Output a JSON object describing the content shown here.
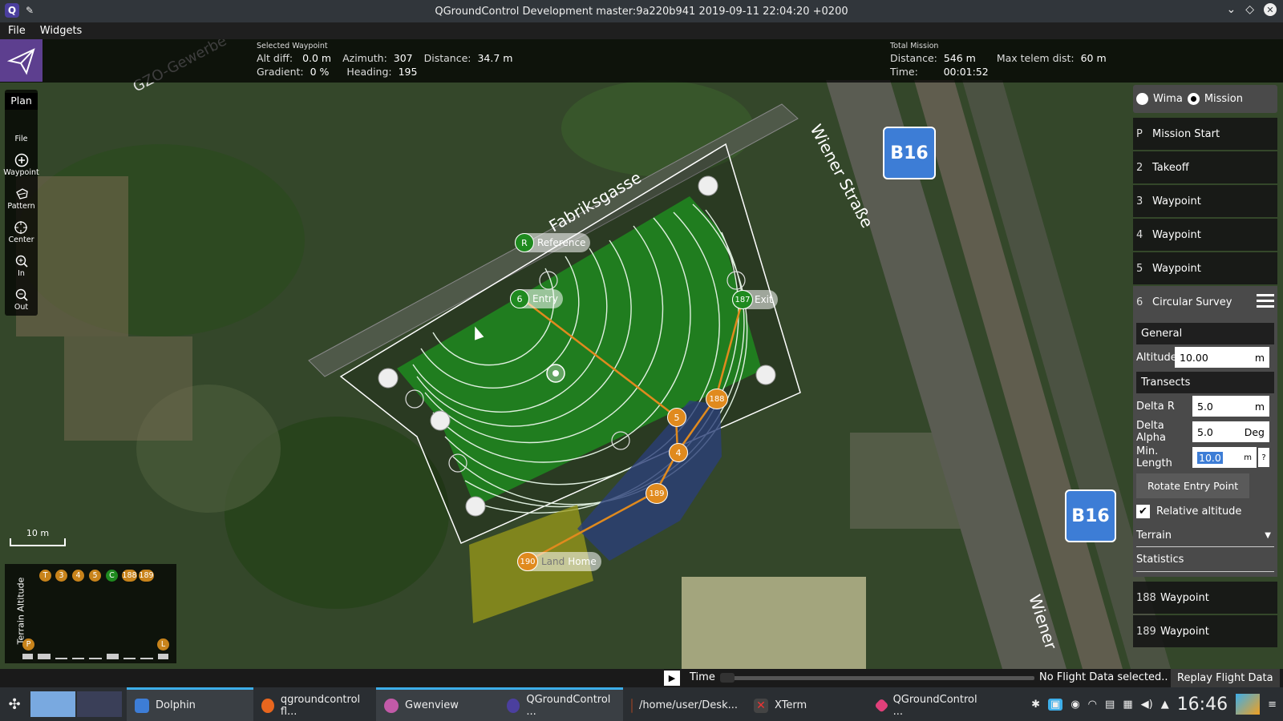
{
  "window": {
    "title": "QGroundControl Development master:9a220b941 2019-09-11 22:04:20 +0200"
  },
  "menu": {
    "file": "File",
    "widgets": "Widgets"
  },
  "selected_waypoint": {
    "caption": "Selected Waypoint",
    "alt_diff_label": "Alt diff:",
    "alt_diff": "0.0 m",
    "azimuth_label": "Azimuth:",
    "azimuth": "307",
    "distance_label": "Distance:",
    "distance": "34.7 m",
    "gradient_label": "Gradient:",
    "gradient": "0 %",
    "heading_label": "Heading:",
    "heading": "195"
  },
  "total_mission": {
    "caption": "Total Mission",
    "distance_label": "Distance:",
    "distance": "546 m",
    "max_telem_label": "Max telem dist:",
    "max_telem": "60 m",
    "time_label": "Time:",
    "time": "00:01:52"
  },
  "toolstrip": {
    "plan": "Plan",
    "tools": [
      {
        "label": "File",
        "icon": "file-icon"
      },
      {
        "label": "Waypoint",
        "icon": "plus-circle-icon"
      },
      {
        "label": "Pattern",
        "icon": "pattern-icon"
      },
      {
        "label": "Center",
        "icon": "crosshair-icon"
      },
      {
        "label": "In",
        "icon": "zoom-in-icon"
      },
      {
        "label": "Out",
        "icon": "zoom-out-icon"
      }
    ]
  },
  "map": {
    "labels": {
      "street1": "Fabriksgasse",
      "street2": "Wiener Straße",
      "street3": "Wiener",
      "street4": "GZO-Gewerbe",
      "shield1": "B16",
      "shield2": "B16"
    },
    "markers": {
      "reference": {
        "badge": "R",
        "label": "Reference"
      },
      "entry": {
        "badge": "6",
        "label": "Entry"
      },
      "exit": {
        "badge": "187",
        "label": "Exit"
      },
      "home": {
        "badge": "190",
        "label": "Home",
        "hidden_label": "Land"
      },
      "wp5": "5",
      "wp4": "4",
      "wp188": "188",
      "wp189": "189"
    },
    "scale_label": "10 m"
  },
  "terrain": {
    "title": "Terrain Altitude",
    "badges": [
      "T",
      "3",
      "4",
      "5",
      "C",
      "188",
      "189"
    ],
    "p": "P",
    "l": "L"
  },
  "mission_panel": {
    "mode_wima": "Wima",
    "mode_mission": "Mission",
    "items": [
      {
        "num": "P",
        "label": "Mission Start"
      },
      {
        "num": "2",
        "label": "Takeoff"
      },
      {
        "num": "3",
        "label": "Waypoint"
      },
      {
        "num": "4",
        "label": "Waypoint"
      },
      {
        "num": "5",
        "label": "Waypoint"
      },
      {
        "num": "6",
        "label": "Circular Survey"
      }
    ],
    "editor": {
      "general": "General",
      "altitude_label": "Altitude",
      "altitude_value": "10.00",
      "altitude_unit": "m",
      "transects": "Transects",
      "delta_r_label": "Delta R",
      "delta_r_value": "5.0",
      "delta_r_unit": "m",
      "delta_alpha_label": "Delta Alpha",
      "delta_alpha_value": "5.0",
      "delta_alpha_unit": "Deg",
      "min_length_label": "Min. Length",
      "min_length_value": "10.0",
      "min_length_unit": "m",
      "min_length_help": "?",
      "rotate_button": "Rotate Entry Point",
      "relative_altitude": "Relative altitude",
      "terrain": "Terrain",
      "statistics": "Statistics"
    },
    "items_after": [
      {
        "num": "188",
        "label": "Waypoint"
      },
      {
        "num": "189",
        "label": "Waypoint"
      }
    ]
  },
  "timebar": {
    "time_label": "Time",
    "status": "No Flight Data selected..",
    "replay_button": "Replay Flight Data"
  },
  "taskbar": {
    "tasks": [
      {
        "label": "Dolphin"
      },
      {
        "label": "qgroundcontrol fl..."
      },
      {
        "label": "Gwenview"
      },
      {
        "label": "QGroundControl ..."
      },
      {
        "label": "/home/user/Desk..."
      },
      {
        "label": "XTerm"
      },
      {
        "label": "QGroundControl ..."
      }
    ],
    "clock": "16:46"
  },
  "colors": {
    "survey_green": "#1f8a1f",
    "path_orange": "#e08a1e",
    "plan_purple": "#5d3f8f",
    "home_yellow": "#9a9a1a",
    "nofly_blue": "#2a3f78"
  }
}
